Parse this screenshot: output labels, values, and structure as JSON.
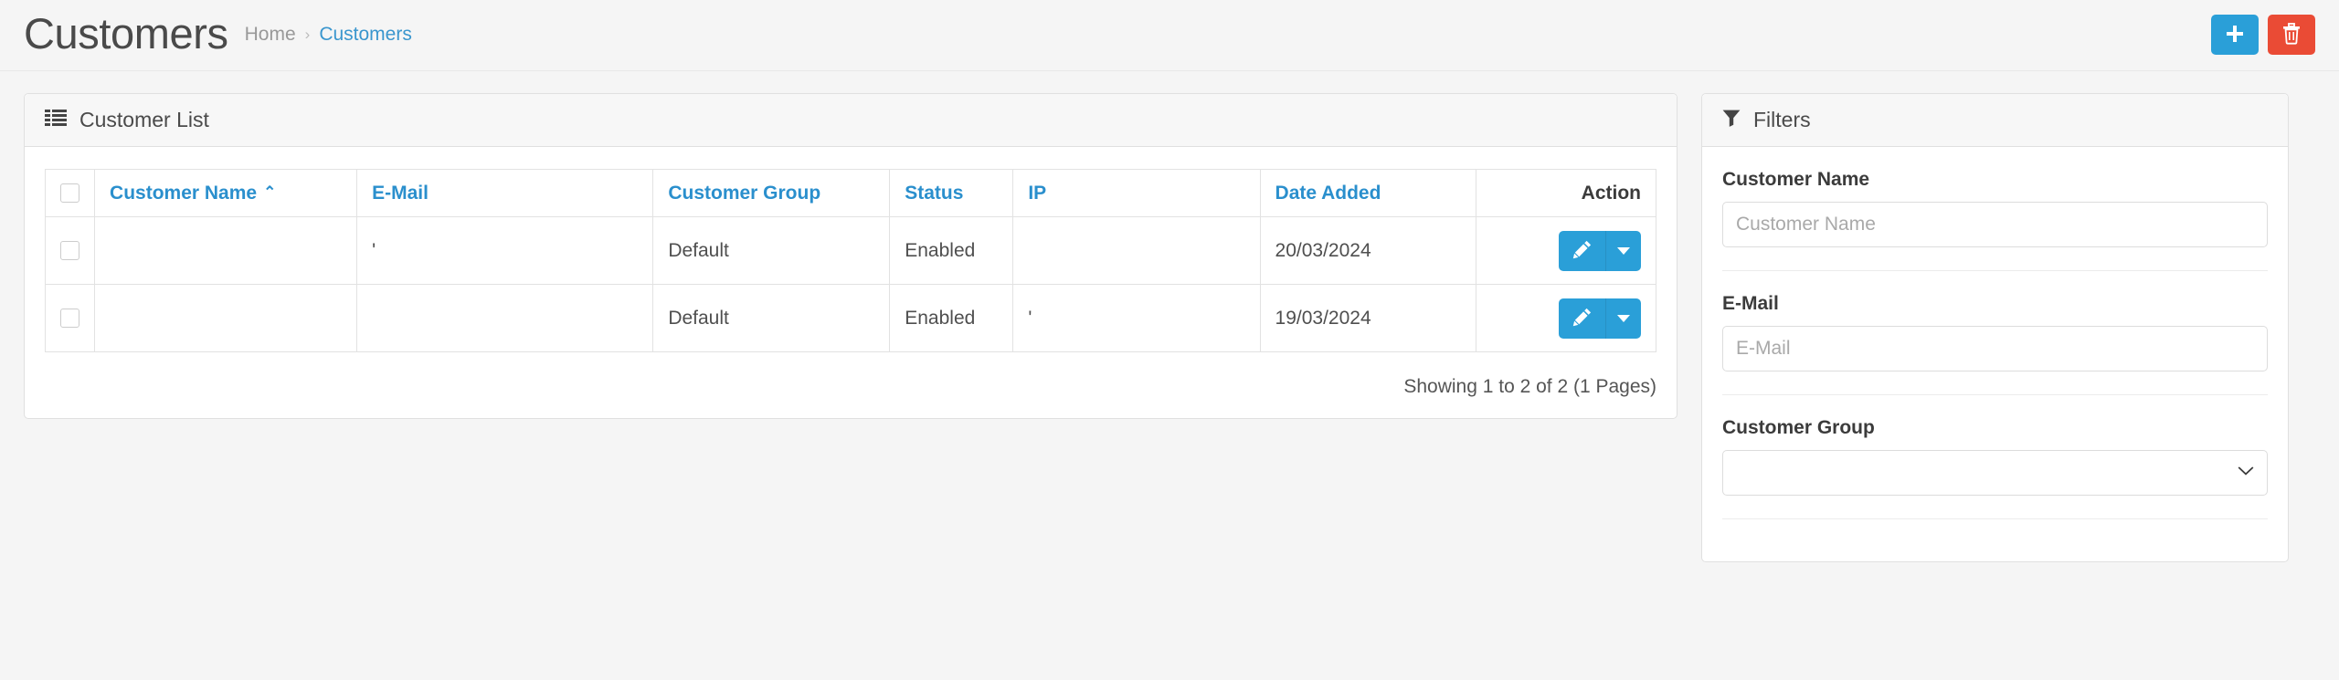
{
  "header": {
    "title": "Customers",
    "breadcrumb": {
      "home": "Home",
      "separator": "›",
      "current": "Customers"
    },
    "actions": {
      "add": {
        "name": "add-new-customer",
        "icon": "plus-icon",
        "color": "#2a9fd8"
      },
      "delete": {
        "name": "delete-selected",
        "icon": "trash-icon",
        "color": "#ea4b35"
      }
    }
  },
  "customer_list": {
    "panel_title": "Customer List",
    "panel_icon": "list-icon",
    "columns": [
      {
        "key": "check",
        "label": "",
        "sortable": false,
        "link": false
      },
      {
        "key": "name",
        "label": "Customer Name",
        "sortable": true,
        "link": true,
        "sort": "asc",
        "sort_caret": "⌃"
      },
      {
        "key": "email",
        "label": "E-Mail",
        "sortable": true,
        "link": true
      },
      {
        "key": "group",
        "label": "Customer Group",
        "sortable": true,
        "link": true
      },
      {
        "key": "status",
        "label": "Status",
        "sortable": true,
        "link": true
      },
      {
        "key": "ip",
        "label": "IP",
        "sortable": true,
        "link": true
      },
      {
        "key": "date",
        "label": "Date Added",
        "sortable": true,
        "link": true
      },
      {
        "key": "action",
        "label": "Action",
        "sortable": false,
        "link": false
      }
    ],
    "rows": [
      {
        "name": "",
        "email": "'",
        "group": "Default",
        "status": "Enabled",
        "ip": "",
        "date": "20/03/2024"
      },
      {
        "name": "",
        "email": "",
        "group": "Default",
        "status": "Enabled",
        "ip": "'",
        "date": "19/03/2024"
      }
    ],
    "row_action": {
      "edit_icon": "pencil-icon",
      "dropdown_icon": "caret-down-icon"
    },
    "footer_text": "Showing 1 to 2 of 2 (1 Pages)"
  },
  "filters": {
    "panel_title": "Filters",
    "panel_icon": "funnel-icon",
    "fields": [
      {
        "name": "customer-name",
        "label": "Customer Name",
        "type": "text",
        "value": "",
        "placeholder": "Customer Name"
      },
      {
        "name": "email",
        "label": "E-Mail",
        "type": "text",
        "value": "",
        "placeholder": "E-Mail"
      },
      {
        "name": "customer-group",
        "label": "Customer Group",
        "type": "select",
        "value": "",
        "placeholder": ""
      }
    ]
  },
  "theme": {
    "link_blue": "#2a8fcd",
    "primary_blue": "#2a9fd8",
    "danger_red": "#ea4b35",
    "page_bg": "#f5f5f5",
    "panel_bg": "#ffffff"
  }
}
